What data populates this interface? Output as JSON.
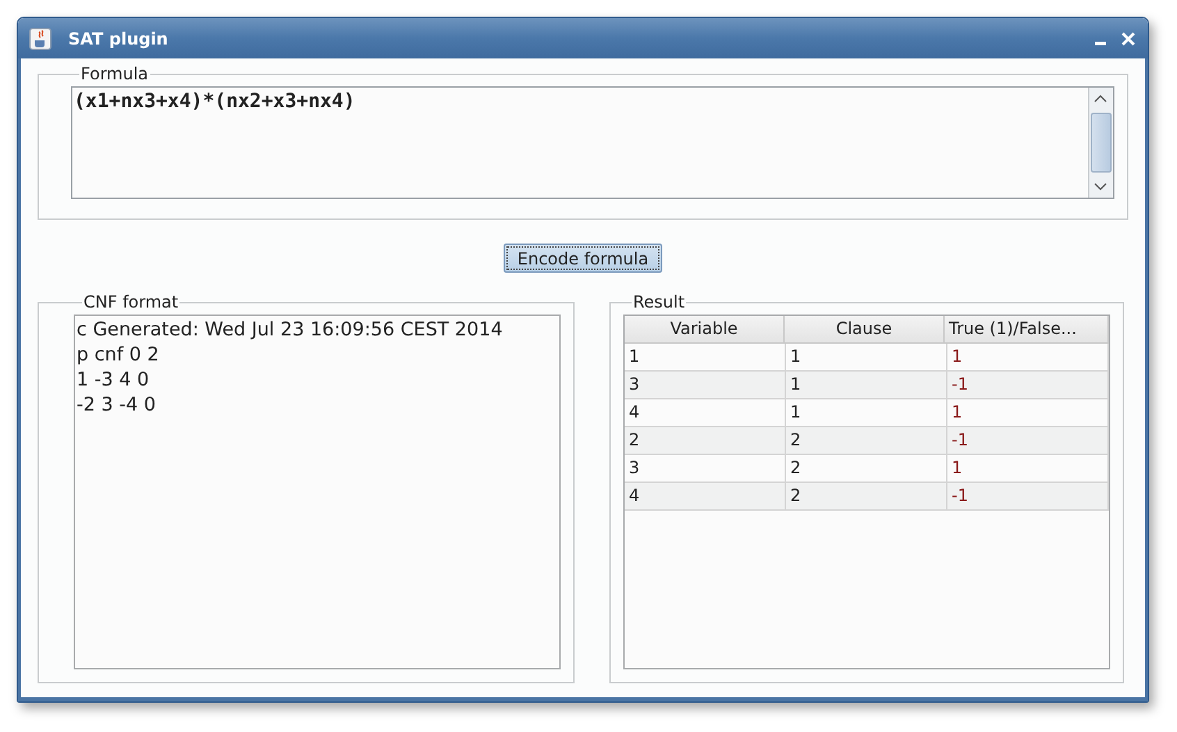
{
  "window": {
    "title": "SAT plugin"
  },
  "formula": {
    "label": "Formula",
    "value": "(x1+nx3+x4)*(nx2+x3+nx4)"
  },
  "encode_button": "Encode formula",
  "cnf": {
    "label": "CNF format",
    "lines": [
      "c Generated: Wed Jul 23 16:09:56 CEST 2014",
      "p cnf 0 2",
      "1 -3 4 0",
      "-2 3 -4 0"
    ]
  },
  "result": {
    "label": "Result",
    "columns": [
      "Variable",
      "Clause",
      "True (1)/False..."
    ],
    "rows": [
      [
        "1",
        "1",
        "1"
      ],
      [
        "3",
        "1",
        "-1"
      ],
      [
        "4",
        "1",
        "1"
      ],
      [
        "2",
        "2",
        "-1"
      ],
      [
        "3",
        "2",
        "1"
      ],
      [
        "4",
        "2",
        "-1"
      ]
    ]
  }
}
